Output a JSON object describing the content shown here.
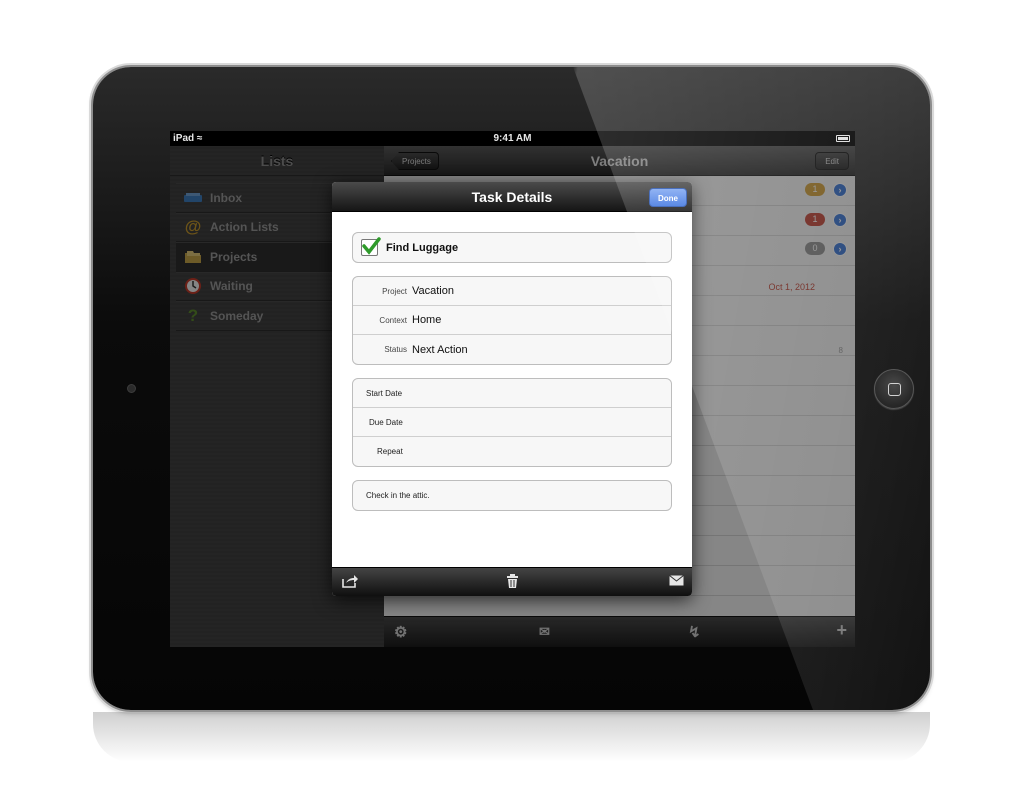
{
  "statusbar": {
    "carrier": "iPad",
    "time": "9:41 AM"
  },
  "master": {
    "title": "Lists",
    "items": [
      {
        "label": "Inbox",
        "icon": "inbox-tray-icon",
        "color": "#3f7fbf"
      },
      {
        "label": "Action Lists",
        "icon": "at-sign-icon",
        "color": "#c79a2c"
      },
      {
        "label": "Projects",
        "icon": "folders-icon",
        "color": "#c7a64a",
        "selected": true
      },
      {
        "label": "Waiting",
        "icon": "clock-icon",
        "color": "#c43b2b"
      },
      {
        "label": "Someday",
        "icon": "question-mark-icon",
        "color": "#5d8a2e"
      }
    ]
  },
  "detail": {
    "back_label": "Projects",
    "title": "Vacation",
    "edit_label": "Edit",
    "badges": [
      {
        "value": "1",
        "color": "#d09a2a"
      },
      {
        "value": "1",
        "color": "#c0392b"
      },
      {
        "value": "0",
        "color": "#8a8a8a"
      }
    ],
    "date": "Oct 1, 2012",
    "note_glyph": "8",
    "toolbar": {
      "icons": [
        "gear-icon",
        "envelope-icon",
        "lightning-icon",
        "plus-icon"
      ]
    }
  },
  "modal": {
    "title": "Task Details",
    "done_label": "Done",
    "task_name": "Find Luggage",
    "task_completed": true,
    "properties": [
      {
        "label": "Project",
        "value": "Vacation"
      },
      {
        "label": "Context",
        "value": "Home"
      },
      {
        "label": "Status",
        "value": "Next Action"
      }
    ],
    "dates": [
      "Start Date",
      "Due Date",
      "Repeat"
    ],
    "note": "Check in the attic.",
    "footer_icons": [
      "share-icon",
      "trash-icon",
      "envelope-icon"
    ]
  },
  "colors": {
    "accent_blue": "#3e75e0",
    "check_green": "#2e9a2a",
    "date_red": "#c03a2b"
  }
}
